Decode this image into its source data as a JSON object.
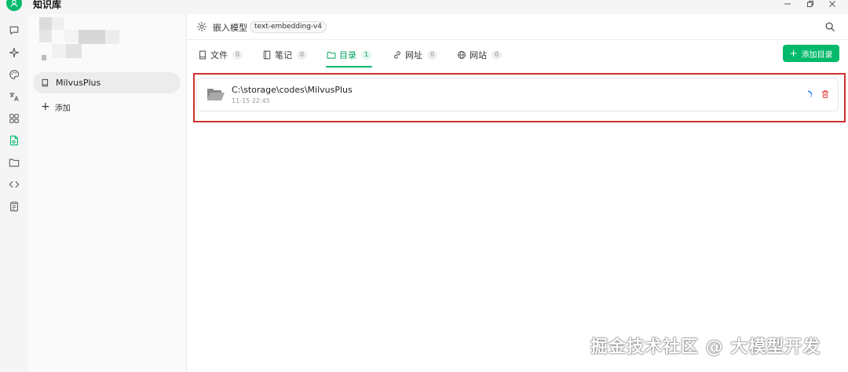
{
  "app": {
    "title": "知识库"
  },
  "window": {
    "minimize_icon": "minimize-icon",
    "restore_icon": "restore-icon",
    "close_icon": "close-icon"
  },
  "rail": {
    "items": [
      {
        "icon": "chat-icon"
      },
      {
        "icon": "sparkle-icon"
      },
      {
        "icon": "palette-icon"
      },
      {
        "icon": "translate-icon"
      },
      {
        "icon": "apps-icon"
      },
      {
        "icon": "knowledge-file-icon",
        "active": true
      },
      {
        "icon": "folder-icon"
      },
      {
        "icon": "code-icon"
      },
      {
        "icon": "clipboard-icon"
      }
    ]
  },
  "kb": {
    "items": [
      {
        "label": "MilvusPlus"
      }
    ],
    "add_label": "添加"
  },
  "topbar": {
    "embed_label": "嵌入模型",
    "model_name": "text-embedding-v4"
  },
  "tabs": [
    {
      "label": "文件",
      "count": "0",
      "icon": "file-icon"
    },
    {
      "label": "笔记",
      "count": "0",
      "icon": "notebook-icon"
    },
    {
      "label": "目录",
      "count": "1",
      "icon": "folder-icon",
      "active": true
    },
    {
      "label": "网址",
      "count": "0",
      "icon": "link-icon"
    },
    {
      "label": "网站",
      "count": "0",
      "icon": "globe-icon"
    }
  ],
  "add_directory_label": "添加目录",
  "directories": [
    {
      "path": "C:\\storage\\codes\\MilvusPlus",
      "time": "11-15 22:45"
    }
  ],
  "watermark": "掘金技术社区 @ 大模型开发",
  "colors": {
    "accent": "#00b96b",
    "highlight_border": "#d32f2f",
    "spinner": "#1677ff",
    "delete": "#e53935"
  }
}
